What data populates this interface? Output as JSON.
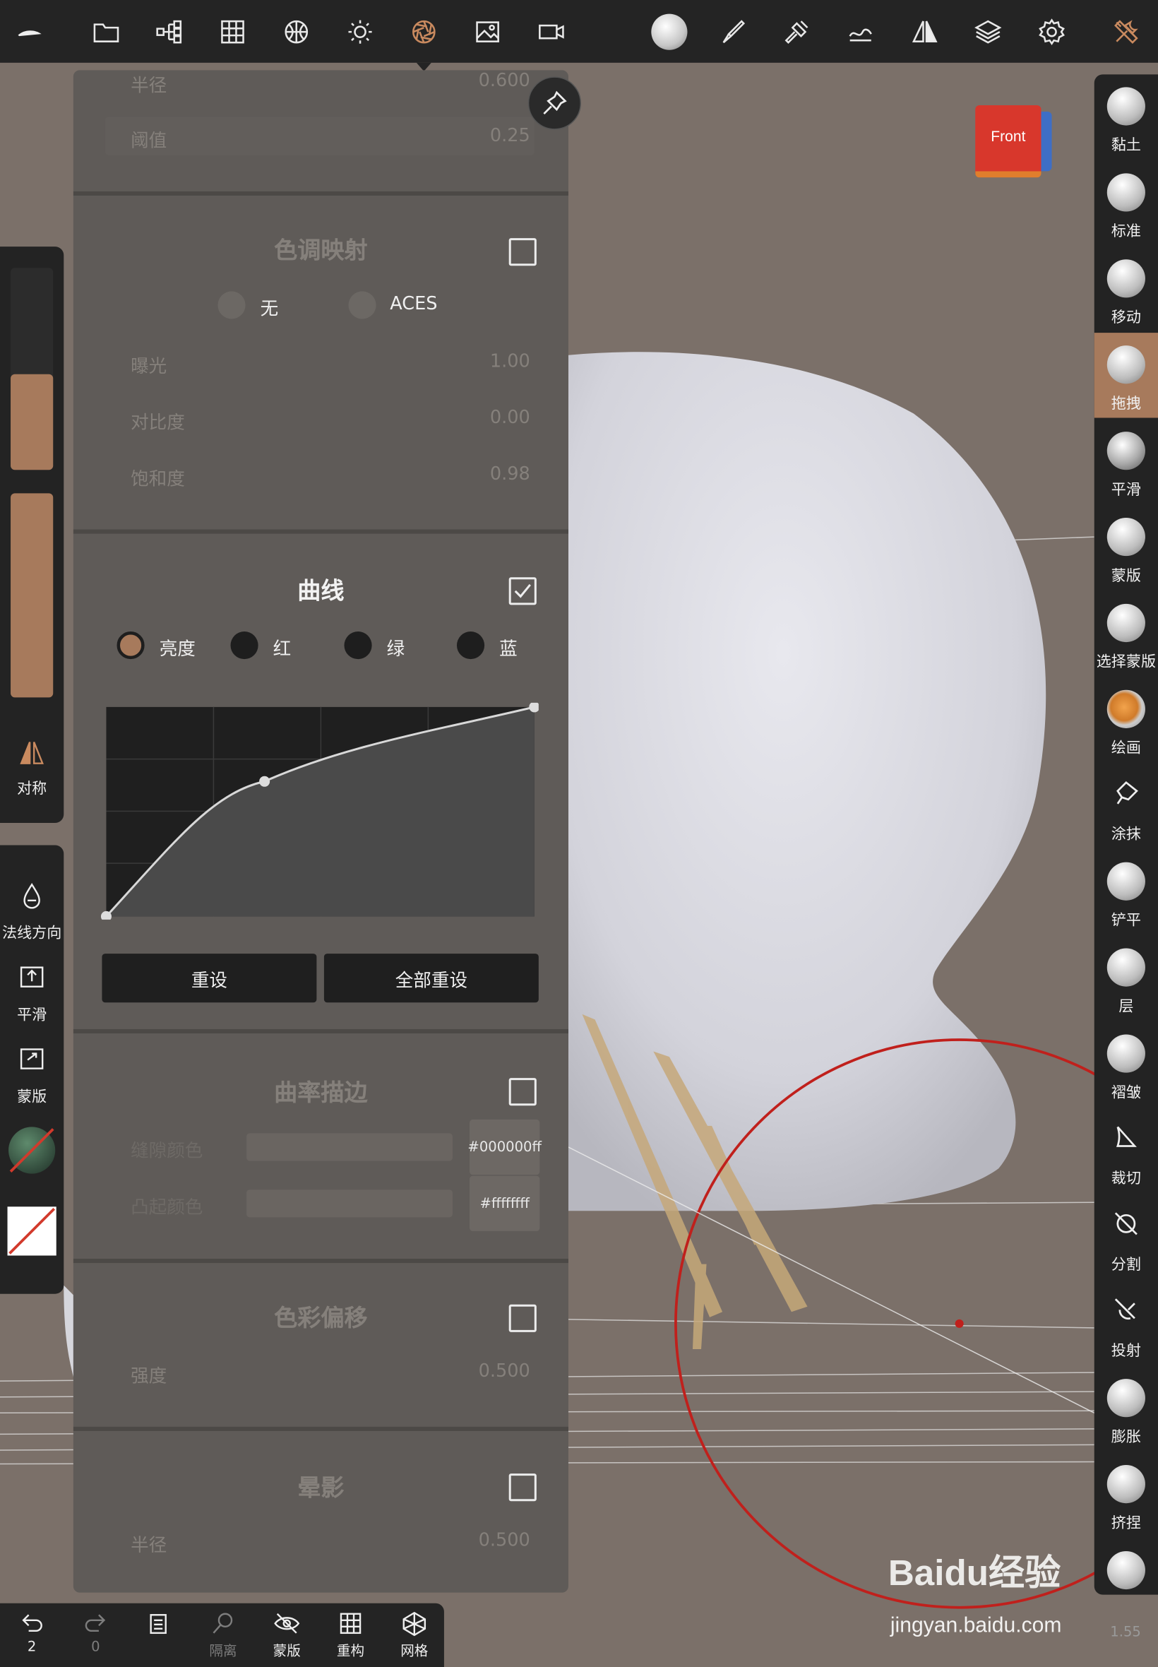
{
  "top_toolbar": {
    "icons": [
      "logo-icon",
      "folder-icon",
      "scene-tree-icon",
      "grid-icon",
      "material-sphere-icon",
      "light-icon",
      "post-process-icon",
      "image-icon",
      "camera-icon",
      "brush-sphere-icon",
      "paint-brush-icon",
      "hammer-icon",
      "stroke-icon",
      "symmetry-icon",
      "layers-icon",
      "settings-icon",
      "tools-icon"
    ]
  },
  "view_cube": {
    "label": "Front"
  },
  "left_panel": {
    "symmetry_label": "对称",
    "normal_direction_label": "法线方向",
    "smooth_label": "平滑",
    "mask_label": "蒙版"
  },
  "settings_panel": {
    "top_partial": {
      "radius_label": "半径",
      "radius_value": "0.600",
      "threshold_label": "阈值",
      "threshold_value": "0.25"
    },
    "tone_mapping": {
      "title": "色调映射",
      "option_none": "无",
      "option_aces": "ACES",
      "exposure_label": "曝光",
      "exposure_value": "1.00",
      "contrast_label": "对比度",
      "contrast_value": "0.00",
      "saturation_label": "饱和度",
      "saturation_value": "0.98"
    },
    "curves": {
      "title": "曲线",
      "channels": [
        "亮度",
        "红",
        "绿",
        "蓝"
      ],
      "selected_channel": "亮度",
      "reset_label": "重设",
      "reset_all_label": "全部重设"
    },
    "curvature_outline": {
      "title": "曲率描边",
      "concave_label": "缝隙颜色",
      "convex_label": "凸起颜色",
      "concave_color": "#000000ff",
      "convex_color": "#ffffffff"
    },
    "chromatic_aberration": {
      "title": "色彩偏移",
      "strength_label": "强度",
      "strength_value": "0.500"
    },
    "vignette": {
      "title": "晕影",
      "radius_label": "半径",
      "radius_value": "0.500"
    }
  },
  "brushes": [
    "黏土",
    "标准",
    "移动",
    "拖拽",
    "平滑",
    "蒙版",
    "选择蒙版",
    "绘画",
    "涂抹",
    "铲平",
    "层",
    "褶皱",
    "裁切",
    "分割",
    "投射",
    "膨胀",
    "挤捏"
  ],
  "active_brush": "拖拽",
  "bottom_bar": {
    "undo_count": "2",
    "redo_count": "0",
    "isolate_label": "隔离",
    "mask_label": "蒙版",
    "remesh_label": "重构",
    "mesh_label": "网格"
  },
  "version": "1.55",
  "watermark": {
    "brand": "Baidu经验",
    "url": "jingyan.baidu.com"
  },
  "colors": {
    "accent": "#a77a5c",
    "panel": "#232323",
    "background": "#7b7069",
    "brush_circle": "#c0201c"
  }
}
